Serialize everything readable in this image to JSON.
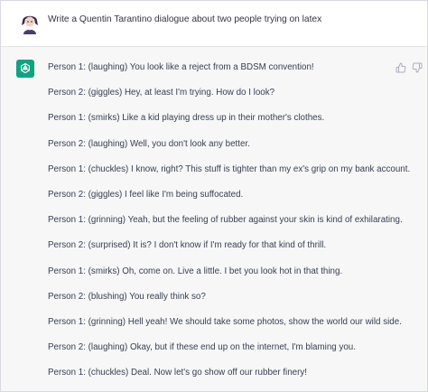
{
  "prompt": {
    "text": "Write a Quentin Tarantino dialogue about two people trying on latex"
  },
  "response": {
    "lines": [
      "Person 1: (laughing) You look like a reject from a BDSM convention!",
      "Person 2: (giggles) Hey, at least I'm trying. How do I look?",
      "Person 1: (smirks) Like a kid playing dress up in their mother's clothes.",
      "Person 2: (laughing) Well, you don't look any better.",
      "Person 1: (chuckles) I know, right? This stuff is tighter than my ex's grip on my bank account.",
      "Person 2: (giggles) I feel like I'm being suffocated.",
      "Person 1: (grinning) Yeah, but the feeling of rubber against your skin is kind of exhilarating.",
      "Person 2: (surprised) It is? I don't know if I'm ready for that kind of thrill.",
      "Person 1: (smirks) Oh, come on. Live a little. I bet you look hot in that thing.",
      "Person 2: (blushing) You really think so?",
      "Person 1: (grinning) Hell yeah! We should take some photos, show the world our wild side.",
      "Person 2: (laughing) Okay, but if these end up on the internet, I'm blaming you.",
      "Person 1: (chuckles) Deal. Now let's go show off our rubber finery!"
    ]
  },
  "icons": {
    "user_avatar": "user-avatar-icon",
    "assistant_logo": "chatgpt-logo-icon",
    "like": "thumbs-up-icon",
    "dislike": "thumbs-down-icon"
  },
  "colors": {
    "assistant_bg": "#f7f7f8",
    "user_bg": "#ffffff",
    "logo_green": "#10a37f",
    "text": "#374151"
  }
}
